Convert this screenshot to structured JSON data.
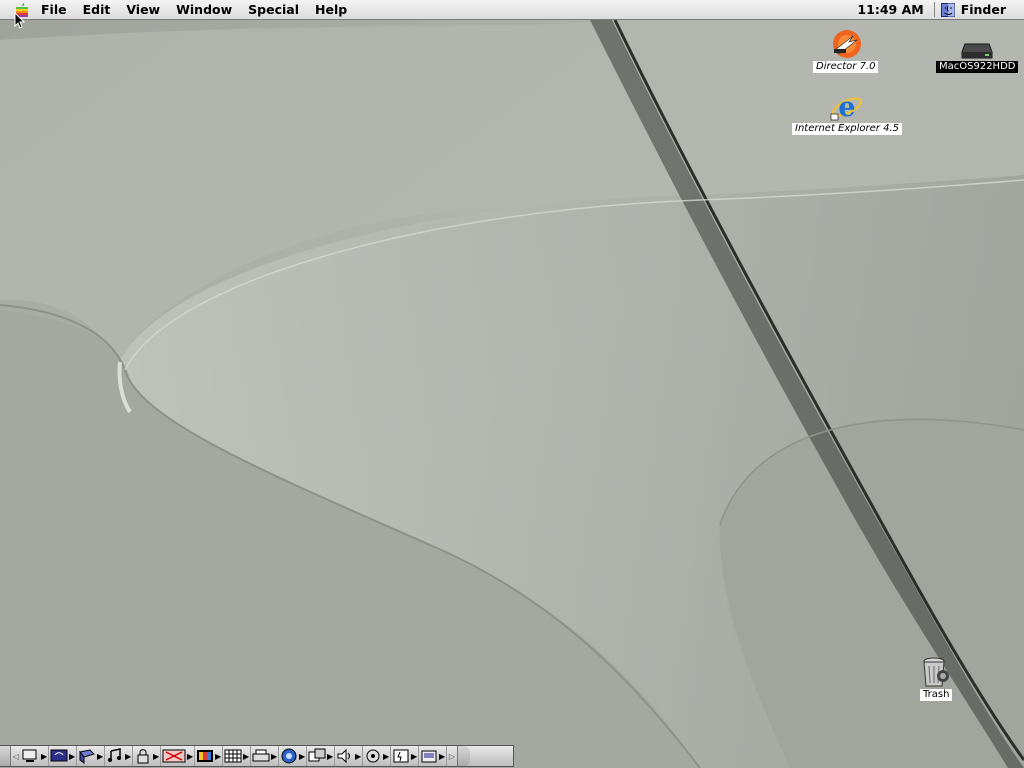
{
  "menubar": {
    "apple_menu": "apple-icon",
    "items": [
      "File",
      "Edit",
      "View",
      "Window",
      "Special",
      "Help"
    ],
    "clock": "11:49 AM",
    "active_app": "Finder"
  },
  "desktop": {
    "icons": {
      "director": {
        "label": "Director 7.0",
        "icon": "director-icon"
      },
      "harddisk": {
        "label": "MacOS922HDD",
        "icon": "hard-disk-icon"
      },
      "explorer": {
        "label": "Internet Explorer 4.5",
        "icon": "internet-explorer-icon"
      },
      "trash": {
        "label": "Trash",
        "icon": "trash-icon"
      }
    }
  },
  "control_strip": {
    "modules": [
      "appletalk-icon",
      "monitor-bit-depth-icon",
      "remote-access-icon",
      "file-sharing-icon",
      "audio-cd-icon",
      "keychain-icon",
      "location-manager-icon",
      "monitor-colors-icon",
      "resolution-icon",
      "printer-icon",
      "quicktime-icon",
      "web-sharing-icon",
      "sound-volume-icon",
      "speech-icon",
      "energy-saver-icon",
      "hard-disk-spindown-icon"
    ]
  },
  "colors": {
    "desktop": "#a9aca5",
    "menubar": "#e6e6e6",
    "selection": "#000000"
  }
}
